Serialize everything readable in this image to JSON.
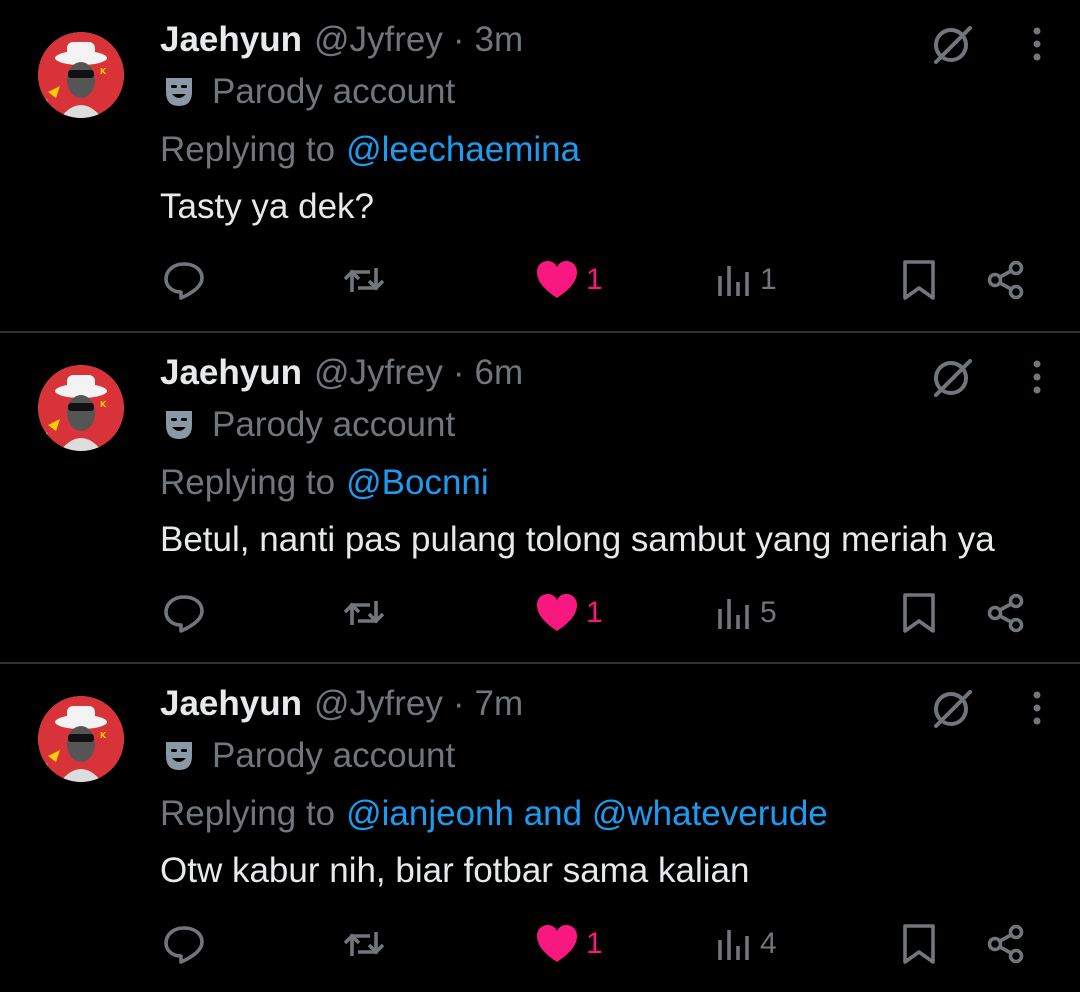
{
  "colors": {
    "background": "#000000",
    "text_primary": "#e7e9ea",
    "text_secondary": "#71767b",
    "mention": "#1d9bf0",
    "like": "#f91880",
    "divider": "#2f3336"
  },
  "icons": [
    "avatar",
    "mask-icon",
    "grok-icon",
    "more-icon",
    "reply-icon",
    "retweet-icon",
    "heart-icon",
    "views-icon",
    "bookmark-icon",
    "share-icon"
  ],
  "tweets": [
    {
      "name": "Jaehyun",
      "handle": "@Jyfrey",
      "dot": "·",
      "time": "3m",
      "parody_label": "Parody account",
      "replying_prefix": "Replying to",
      "replying_to": "@leechaemina",
      "text": "Tasty ya dek?",
      "likes": "1",
      "views": "1"
    },
    {
      "name": "Jaehyun",
      "handle": "@Jyfrey",
      "dot": "·",
      "time": "6m",
      "parody_label": "Parody account",
      "replying_prefix": "Replying to",
      "replying_to": "@Bocnni",
      "text": "Betul, nanti pas pulang tolong sambut yang meriah ya",
      "likes": "1",
      "views": "5"
    },
    {
      "name": "Jaehyun",
      "handle": "@Jyfrey",
      "dot": "·",
      "time": "7m",
      "parody_label": "Parody account",
      "replying_prefix": "Replying to",
      "replying_to": "@ianjeonh and @whateverude",
      "text": "Otw kabur nih, biar fotbar sama kalian",
      "likes": "1",
      "views": "4"
    }
  ]
}
